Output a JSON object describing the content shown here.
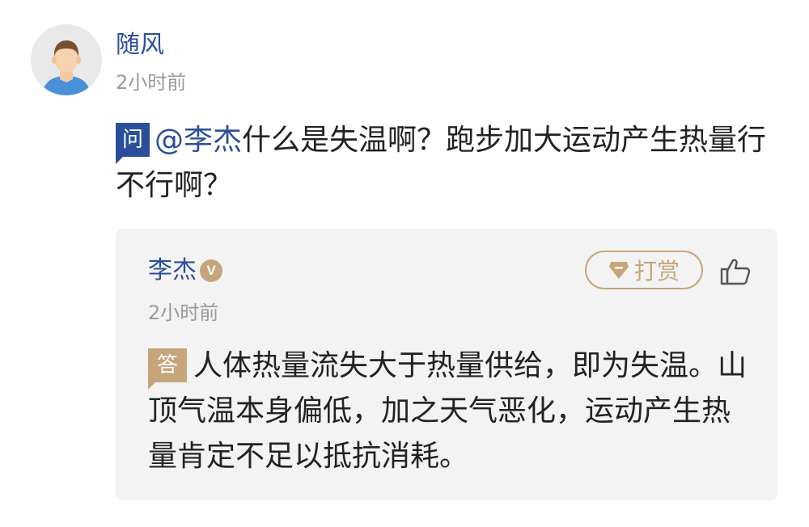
{
  "question_post": {
    "author": "随风",
    "time": "2小时前",
    "badge": "问",
    "mention": "@李杰",
    "text": "什么是失温啊？跑步加大运动产生热量行不行啊？"
  },
  "answer": {
    "author": "李杰",
    "verified_badge": "V",
    "reward_label": "打赏",
    "time": "2小时前",
    "badge": "答",
    "text": "人体热量流失大于热量供给，即为失温。山顶气温本身偏低，加之天气恶化，运动产生热量肯定不足以抵抗消耗。"
  },
  "icons": {
    "avatar": "default-user-avatar-icon",
    "reward": "gem-icon",
    "like": "thumbs-up-icon"
  },
  "colors": {
    "link_blue": "#2b4f9b",
    "gold": "#c6a57b",
    "meta_gray": "#9a9a9a",
    "answer_bg": "#f3f3f3"
  }
}
